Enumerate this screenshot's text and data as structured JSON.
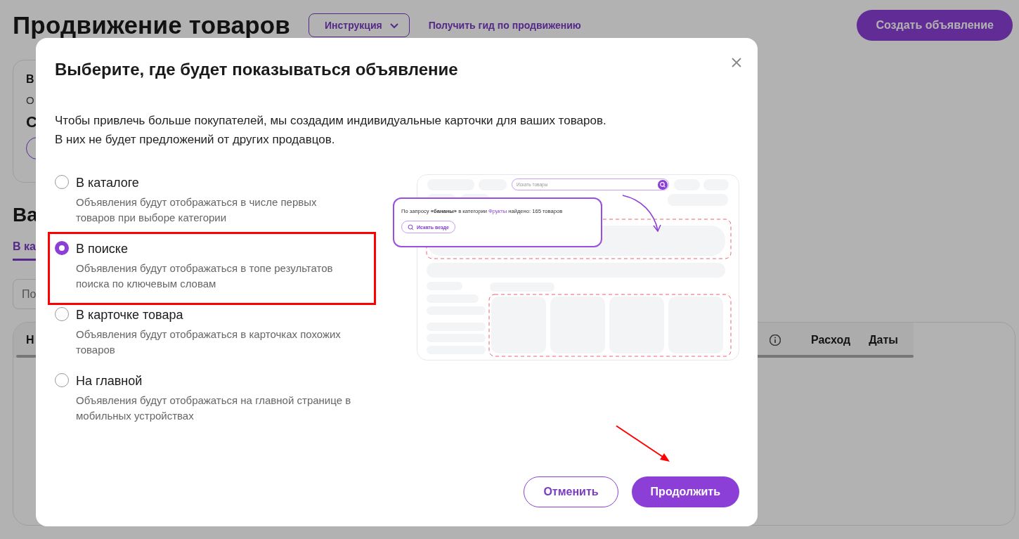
{
  "page": {
    "title": "Продвижение товаров",
    "instruction_button": "Инструкция",
    "guide_link": "Получить гид по продвижению",
    "create_button": "Создать объявление",
    "card": [
      {
        "kind": "title",
        "text": "В"
      },
      {
        "kind": "text",
        "text": "О"
      },
      {
        "kind": "value",
        "text": "С"
      }
    ],
    "section_heading": "Ва",
    "tab": {
      "label": "В ка",
      "selected": true
    },
    "search": {
      "placeholder": "По"
    },
    "table": {
      "columns": [
        "Н",
        "Расход",
        "Даты"
      ]
    }
  },
  "modal": {
    "title": "Выберите, где будет показываться объявление",
    "description": [
      "Чтобы привлечь больше покупателей, мы создадим индивидуальные карточки для ваших товаров.",
      "В них не будет предложений от других продавцов."
    ],
    "options": [
      {
        "label": "В каталоге",
        "hint": "Объявления будут отображаться в числе первых товаров при выборе категории",
        "selected": false
      },
      {
        "label": "В поиске",
        "hint": "Объявления будут отображаться в топе результатов поиска по ключевым словам",
        "selected": true
      },
      {
        "label": "В карточке товара",
        "hint": "Объявления будут отображаться в карточках похожих товаров",
        "selected": false
      },
      {
        "label": "На главной",
        "hint": "Объявления будут отображаться на главной странице в мобильных устройствах",
        "selected": false
      }
    ],
    "illustration": {
      "search_placeholder": "Искать товары",
      "result_parts": [
        {
          "kind": "plain",
          "text": "По запросу "
        },
        {
          "kind": "bold",
          "text": "«бананы»"
        },
        {
          "kind": "plain",
          "text": " в категории "
        },
        {
          "kind": "accent",
          "text": "Фрукты"
        },
        {
          "kind": "plain",
          "text": " найдено: 165 товаров"
        }
      ],
      "search_all_button": "Искать везде"
    },
    "buttons": [
      {
        "kind": "secondary",
        "label": "Отменить"
      },
      {
        "kind": "primary",
        "label": "Продолжить"
      }
    ]
  }
}
